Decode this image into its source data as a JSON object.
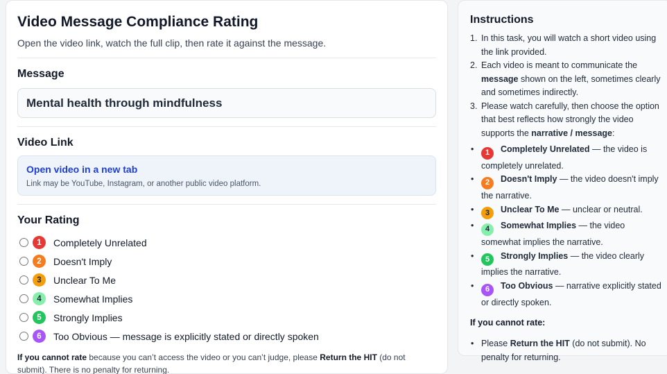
{
  "main": {
    "title": "Video Message Compliance Rating",
    "subtitle": "Open the video link, watch the full clip, then rate it against the message.",
    "message_heading": "Message",
    "message_text": "Mental health through mindfulness",
    "video_heading": "Video Link",
    "video_link_text": "Open video in a new tab",
    "video_note": "Link may be YouTube, Instagram, or another public video platform.",
    "rating_heading": "Your Rating",
    "ratings": [
      {
        "num": "1",
        "label": "Completely Unrelated",
        "color": "#e53935"
      },
      {
        "num": "2",
        "label": "Doesn't Imply",
        "color": "#f57c1f"
      },
      {
        "num": "3",
        "label": "Unclear To Me",
        "color": "#f59e0b"
      },
      {
        "num": "4",
        "label": "Somewhat Implies",
        "color": "#86efac"
      },
      {
        "num": "5",
        "label": "Strongly Implies",
        "color": "#22c55e"
      },
      {
        "num": "6",
        "label": "Too Obvious — message is explicitly stated or directly spoken",
        "color": "#a855f7"
      }
    ],
    "cannot_rate": {
      "lead": "If you cannot rate",
      "mid": " because you can’t access the video or you can’t judge, please ",
      "action": "Return the HIT",
      "tail": " (do not submit). There is no penalty for returning."
    }
  },
  "instructions": {
    "title": "Instructions",
    "steps": {
      "s1": {
        "num": "1.",
        "text": "In this task, you will watch a short video using the link provided."
      },
      "s2": {
        "num": "2.",
        "pre": "Each video is meant to communicate the ",
        "bold": "message",
        "post": " shown on the left, sometimes clearly and sometimes indirectly."
      },
      "s3": {
        "num": "3.",
        "pre": "Please watch carefully, then choose the option that best reflects how strongly the video supports the ",
        "bold": "narrative / message",
        "post": ":"
      }
    },
    "bullet": "•",
    "scale": [
      {
        "num": "1",
        "name": "Completely Unrelated",
        "desc": " — the video is completely unrelated."
      },
      {
        "num": "2",
        "name": "Doesn't Imply",
        "desc": " — the video doesn't imply the narrative."
      },
      {
        "num": "3",
        "name": "Unclear To Me",
        "desc": " — unclear or neutral."
      },
      {
        "num": "4",
        "name": "Somewhat Implies",
        "desc": " — the video somewhat implies the narrative."
      },
      {
        "num": "5",
        "name": "Strongly Implies",
        "desc": " — the video clearly implies the narrative."
      },
      {
        "num": "6",
        "name": "Too Obvious",
        "desc": " — narrative explicitly stated or directly spoken."
      }
    ],
    "cannot_rate_heading": "If you cannot rate:",
    "cannot_rate": {
      "pre": "Please ",
      "bold": "Return the HIT",
      "post": " (do not submit). No penalty for returning."
    }
  }
}
